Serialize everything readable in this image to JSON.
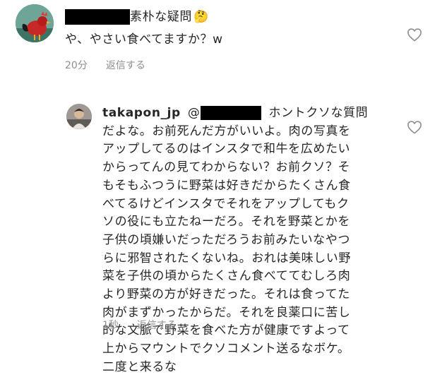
{
  "comment1": {
    "avatar_icon": "rooster-avatar",
    "header_text": "素朴な疑問",
    "emoji": "🤔",
    "body": "や、やさい食べてますか？w",
    "time": "20分",
    "reply_label": "返信する",
    "heart_icon": "heart-outline-icon"
  },
  "comment2": {
    "avatar_icon": "user-avatar",
    "username": "takapon_jp",
    "mention_prefix": "@",
    "first_line_rest": "ホントクソな質問",
    "lines": [
      "だよな。お前死んだ方がいいよ。肉の写真を",
      "アップしてるのはインスタで和牛を広めたい",
      "からってんの見てわからない？お前クソ？そ",
      "もそもふつうに野菜は好きだからたくさん食",
      "べてるけどインスタでそれをアップしてもク",
      "ソの役にも立たねーだろ。それを野菜とかを",
      "子供の頃嫌いだっただろうお前みたいなやつ",
      "らに邪智されたくないね。おれは美味しい野",
      "菜を子供の頃からたくさん食べててむしろ肉",
      "より野菜の方が好きだった。それは食ってた",
      "肉がまずかったからだ。それを良薬口に苦し",
      "的な文脈で野菜を食べた方が健康ですよって",
      "上からマウントでクソコメント送るなボケ。",
      "二度と来るな"
    ],
    "time": "1秒",
    "reply_label": "返信する",
    "heart_icon": "heart-outline-icon"
  }
}
